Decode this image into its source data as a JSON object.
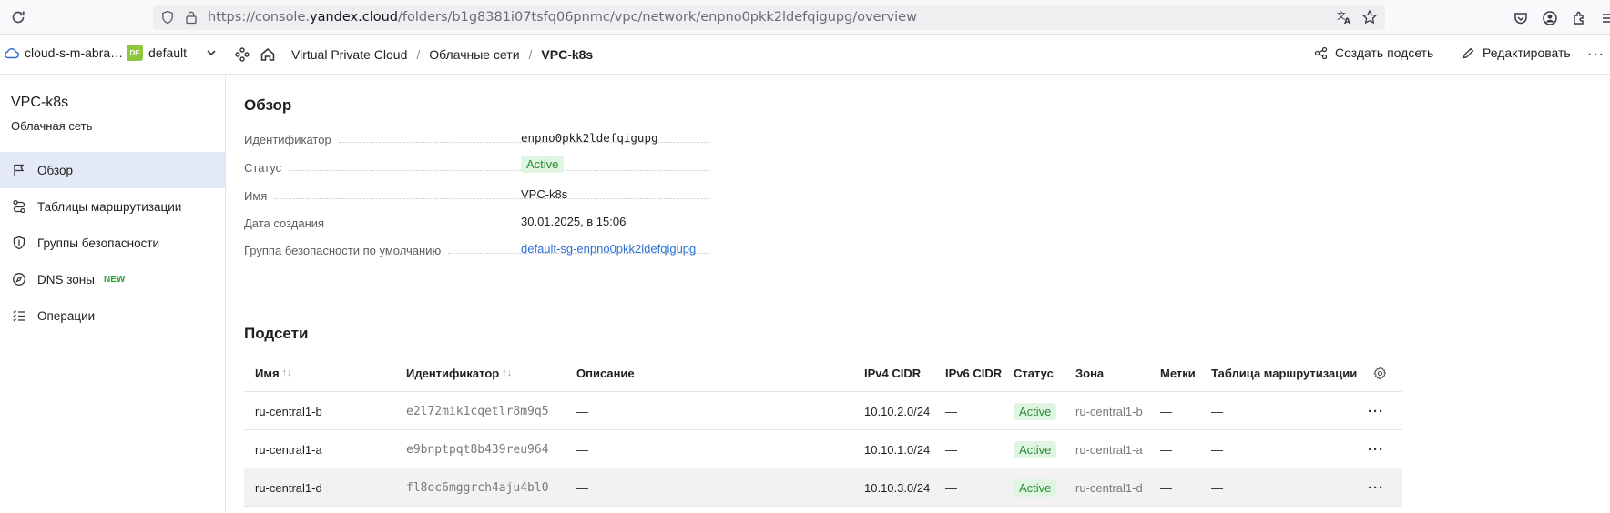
{
  "browser": {
    "url_prefix": "https://console.",
    "url_domain": "yandex.cloud",
    "url_path": "/folders/b1g8381i07tsfq06pnmc/vpc/network/enpno0pkk2ldefqigupg/overview"
  },
  "header": {
    "cloud_name": "cloud-s-m-abra…",
    "folder_badge": "DE",
    "folder_name": "default",
    "breadcrumbs": [
      "Virtual Private Cloud",
      "Облачные сети",
      "VPC-k8s"
    ],
    "create_subnet": "Создать подсеть",
    "edit": "Редактировать"
  },
  "sidebar": {
    "title": "VPC-k8s",
    "subtitle": "Облачная сеть",
    "items": [
      {
        "label": "Обзор",
        "icon": "flag-icon"
      },
      {
        "label": "Таблицы маршрутизации",
        "icon": "route-icon"
      },
      {
        "label": "Группы безопасности",
        "icon": "shield-icon"
      },
      {
        "label": "DNS зоны",
        "icon": "compass-icon",
        "badge": "NEW"
      },
      {
        "label": "Операции",
        "icon": "list-icon"
      }
    ]
  },
  "overview": {
    "title": "Обзор",
    "props": [
      {
        "key": "Идентификатор",
        "value": "enpno0pkk2ldefqigupg"
      },
      {
        "key": "Статус",
        "value": "Active"
      },
      {
        "key": "Имя",
        "value": "VPC-k8s"
      },
      {
        "key": "Дата создания",
        "value": "30.01.2025, в 15:06"
      },
      {
        "key": "Группа безопасности по умолчанию",
        "value": "default-sg-enpno0pkk2ldefqigupg"
      }
    ]
  },
  "subnets": {
    "title": "Подсети",
    "columns": [
      "Имя",
      "Идентификатор",
      "Описание",
      "IPv4 CIDR",
      "IPv6 CIDR",
      "Статус",
      "Зона",
      "Метки",
      "Таблица маршрутизации"
    ],
    "sort_glyph": "↑↓",
    "more_glyph": "···",
    "rows": [
      {
        "name": "ru-central1-b",
        "id": "e2l72mik1cqetlr8m9q5",
        "desc": "—",
        "ipv4": "10.10.2.0/24",
        "ipv6": "—",
        "status": "Active",
        "zone": "ru-central1-b",
        "labels": "—",
        "route": "—"
      },
      {
        "name": "ru-central1-a",
        "id": "e9bnptpqt8b439reu964",
        "desc": "—",
        "ipv4": "10.10.1.0/24",
        "ipv6": "—",
        "status": "Active",
        "zone": "ru-central1-a",
        "labels": "—",
        "route": "—"
      },
      {
        "name": "ru-central1-d",
        "id": "fl8oc6mggrch4aju4bl0",
        "desc": "—",
        "ipv4": "10.10.3.0/24",
        "ipv6": "—",
        "status": "Active",
        "zone": "ru-central1-d",
        "labels": "—",
        "route": "—"
      }
    ]
  },
  "colors": {
    "accent": "#2d6fd6",
    "active_bg": "#dff5e1",
    "active_fg": "#2a8c36",
    "nav_active": "#e4e9f7"
  }
}
